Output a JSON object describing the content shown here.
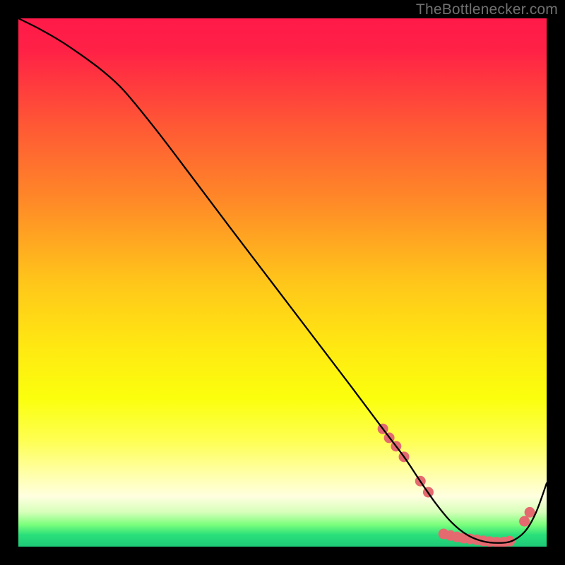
{
  "watermark": "TheBottlenecker.com",
  "chart_data": {
    "type": "line",
    "title": "",
    "xlabel": "",
    "ylabel": "",
    "xlim": [
      0,
      100
    ],
    "ylim": [
      0,
      100
    ],
    "grid": false,
    "background_gradient": {
      "stops": [
        {
          "offset": 0.0,
          "color": "#ff1a49"
        },
        {
          "offset": 0.06,
          "color": "#ff2146"
        },
        {
          "offset": 0.2,
          "color": "#ff5735"
        },
        {
          "offset": 0.35,
          "color": "#ff8b27"
        },
        {
          "offset": 0.5,
          "color": "#ffc61a"
        },
        {
          "offset": 0.62,
          "color": "#ffe812"
        },
        {
          "offset": 0.72,
          "color": "#fbff0d"
        },
        {
          "offset": 0.8,
          "color": "#feff53"
        },
        {
          "offset": 0.86,
          "color": "#ffffa6"
        },
        {
          "offset": 0.905,
          "color": "#ffffe0"
        },
        {
          "offset": 0.935,
          "color": "#d6ffb9"
        },
        {
          "offset": 0.958,
          "color": "#7cff7c"
        },
        {
          "offset": 0.978,
          "color": "#29e07a"
        },
        {
          "offset": 1.0,
          "color": "#1ec877"
        }
      ]
    },
    "series": [
      {
        "name": "bottleneck-curve",
        "color": "#000000",
        "stroke_width": 2.3,
        "x": [
          0,
          4,
          8,
          12,
          16,
          20,
          26,
          33,
          40,
          48,
          56,
          63,
          69,
          73,
          76,
          79,
          82,
          85,
          88,
          91,
          93.5,
          96,
          98,
          100
        ],
        "y": [
          100,
          98,
          95.7,
          93,
          90,
          86.3,
          79,
          69.8,
          60.5,
          50,
          39.5,
          30.3,
          22.3,
          17,
          12.5,
          8.2,
          4.6,
          2.2,
          1.0,
          0.7,
          1.1,
          3.0,
          6.5,
          12.0
        ]
      }
    ],
    "markers": {
      "name": "highlighted-range",
      "color": "#e46a6f",
      "radius": 7.5,
      "points": [
        {
          "x": 69.0,
          "y": 22.3
        },
        {
          "x": 70.2,
          "y": 20.6
        },
        {
          "x": 71.5,
          "y": 19.0
        },
        {
          "x": 73.0,
          "y": 17.0
        },
        {
          "x": 76.1,
          "y": 12.4
        },
        {
          "x": 77.6,
          "y": 10.3
        },
        {
          "x": 80.5,
          "y": 2.4
        },
        {
          "x": 81.8,
          "y": 2.1
        },
        {
          "x": 83.0,
          "y": 1.85
        },
        {
          "x": 84.3,
          "y": 1.6
        },
        {
          "x": 85.5,
          "y": 1.45
        },
        {
          "x": 86.8,
          "y": 1.3
        },
        {
          "x": 88.0,
          "y": 1.1
        },
        {
          "x": 89.2,
          "y": 0.95
        },
        {
          "x": 90.5,
          "y": 0.85
        },
        {
          "x": 91.8,
          "y": 0.85
        },
        {
          "x": 93.0,
          "y": 1.05
        },
        {
          "x": 95.8,
          "y": 4.8
        },
        {
          "x": 96.8,
          "y": 6.5
        }
      ]
    }
  }
}
